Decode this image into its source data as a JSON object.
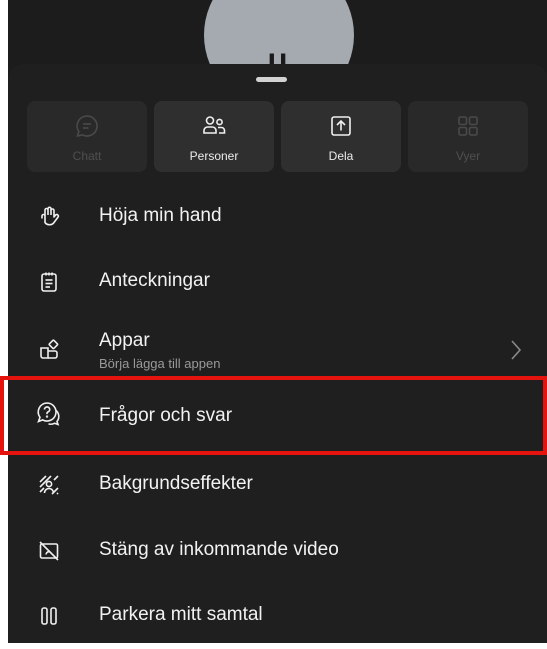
{
  "call": {
    "avatar_initials": "II"
  },
  "quick_actions": [
    {
      "label": "Chatt",
      "icon": "chat-icon",
      "enabled": false
    },
    {
      "label": "Personer",
      "icon": "people-icon",
      "enabled": true
    },
    {
      "label": "Dela",
      "icon": "share-icon",
      "enabled": true
    },
    {
      "label": "Vyer",
      "icon": "views-grid-icon",
      "enabled": false
    }
  ],
  "menu": [
    {
      "label": "Höja min hand",
      "icon": "raise-hand-icon"
    },
    {
      "label": "Anteckningar",
      "icon": "notes-icon"
    },
    {
      "label": "Appar",
      "sublabel": "Börja lägga till appen",
      "icon": "apps-icon",
      "has_chevron": true
    },
    {
      "label": "Frågor och svar",
      "icon": "qa-icon",
      "highlighted": true
    },
    {
      "label": "Bakgrundseffekter",
      "icon": "background-effects-icon"
    },
    {
      "label": "Stäng av inkommande video",
      "icon": "video-off-icon"
    },
    {
      "label": "Parkera mitt samtal",
      "icon": "park-call-icon"
    }
  ],
  "colors": {
    "sheet": "#1f1f1f",
    "tile": "#2f2f2f",
    "highlight": "#e5130e",
    "text": "#f2f2f2",
    "subtext": "#9a9a9a"
  }
}
